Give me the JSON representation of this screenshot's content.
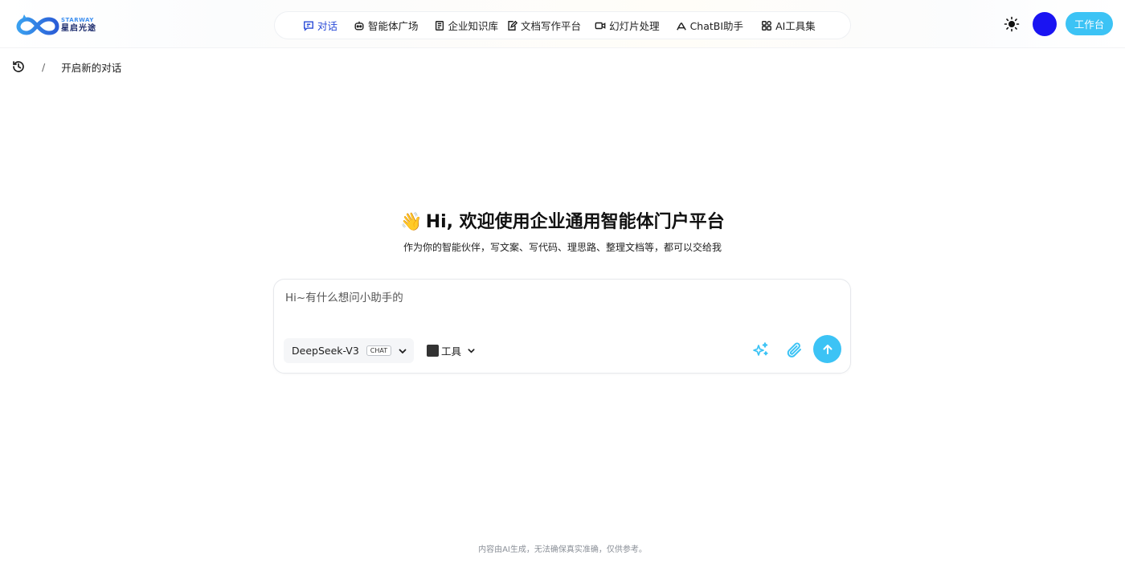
{
  "brand": {
    "name_en": "STARWAY",
    "name_cn": "星启光途"
  },
  "nav": {
    "items": [
      {
        "label": "对话",
        "icon": "chat-icon",
        "active": true
      },
      {
        "label": "智能体广场",
        "icon": "bot-icon"
      },
      {
        "label": "企业知识库",
        "icon": "book-icon"
      },
      {
        "label": "文档写作平台",
        "icon": "edit-doc-icon"
      },
      {
        "label": "幻灯片处理",
        "icon": "video-icon"
      },
      {
        "label": "ChatBI助手",
        "icon": "chart-icon"
      },
      {
        "label": "AI工具集",
        "icon": "grid-icon"
      }
    ]
  },
  "header": {
    "workbench_label": "工作台"
  },
  "breadcrumb": {
    "separator": "/",
    "current": "开启新的对话"
  },
  "welcome": {
    "emoji": "👋",
    "title": "Hi, 欢迎使用企业通用智能体门户平台",
    "subtitle": "作为你的智能伙伴，写文案、写代码、理思路、整理文档等，都可以交给我"
  },
  "composer": {
    "placeholder": "Hi~有什么想问小助手的",
    "model_name": "DeepSeek-V3",
    "model_badge": "CHAT",
    "tools_label": "工具"
  },
  "footer": {
    "note": "内容由AI生成，无法确保真实准确，仅供参考。"
  },
  "colors": {
    "accent": "#3cc3f5",
    "nav_active": "#2a4bd7",
    "avatar": "#1a14f2"
  }
}
